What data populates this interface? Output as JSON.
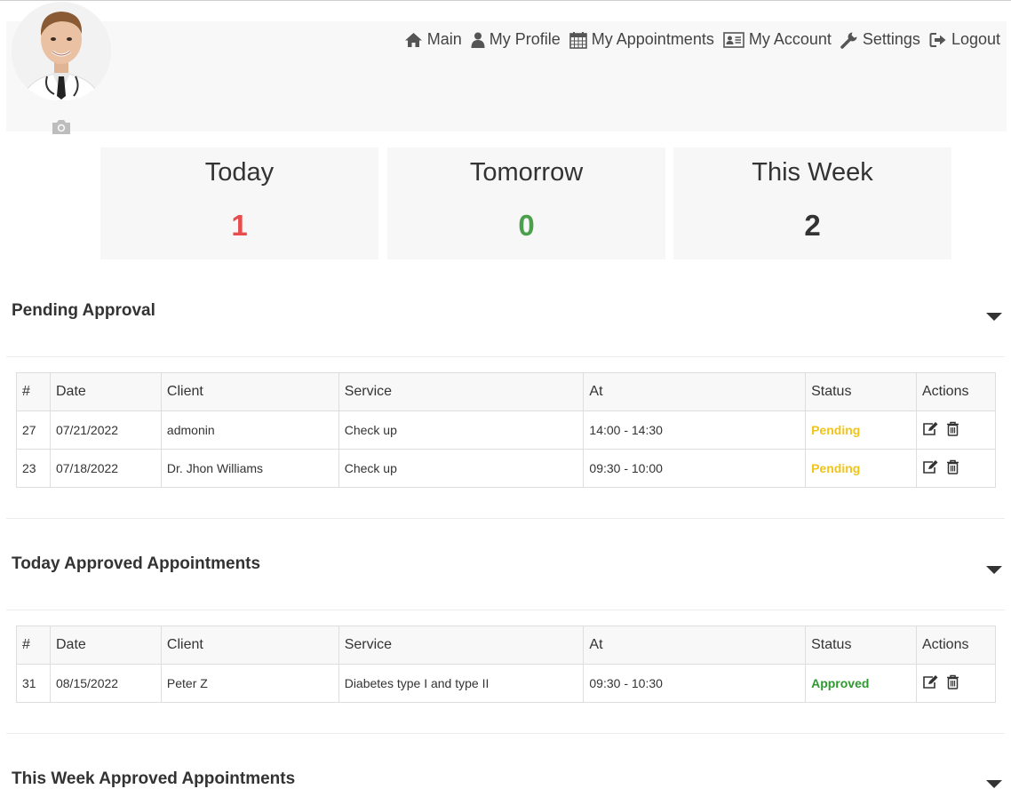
{
  "nav": {
    "items": [
      {
        "label": "Main",
        "icon": "home-icon"
      },
      {
        "label": "My Profile",
        "icon": "user-icon"
      },
      {
        "label": "My Appointments",
        "icon": "calendar-icon"
      },
      {
        "label": "My Account",
        "icon": "id-card-icon"
      },
      {
        "label": "Settings",
        "icon": "wrench-icon"
      },
      {
        "label": "Logout",
        "icon": "logout-icon"
      }
    ]
  },
  "stats": [
    {
      "label": "Today",
      "value": "1",
      "color": "#e84c4c"
    },
    {
      "label": "Tomorrow",
      "value": "0",
      "color": "#4ca04c"
    },
    {
      "label": "This Week",
      "value": "2",
      "color": "#333333"
    }
  ],
  "columns": [
    "#",
    "Date",
    "Client",
    "Service",
    "At",
    "Status",
    "Actions"
  ],
  "sections": {
    "pending": {
      "title": "Pending Approval",
      "rows": [
        {
          "id": "27",
          "date": "07/21/2022",
          "client": "admonin",
          "service": "Check up",
          "at": "14:00 - 14:30",
          "status": "Pending"
        },
        {
          "id": "23",
          "date": "07/18/2022",
          "client": "Dr. Jhon Williams",
          "service": "Check up",
          "at": "09:30 - 10:00",
          "status": "Pending"
        }
      ]
    },
    "today": {
      "title": "Today Approved Appointments",
      "rows": [
        {
          "id": "31",
          "date": "08/15/2022",
          "client": "Peter Z",
          "service": "Diabetes type I and type II",
          "at": "09:30 - 10:30",
          "status": "Approved"
        }
      ]
    },
    "week": {
      "title": "This Week Approved Appointments"
    }
  },
  "colors": {
    "pending": "#f0c419",
    "approved": "#2e9a2e"
  }
}
